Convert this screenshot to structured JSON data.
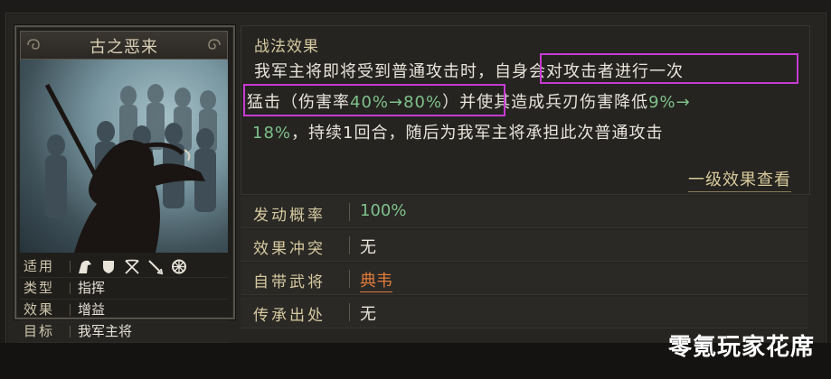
{
  "card": {
    "title": "古之恶来",
    "properties": [
      {
        "key": "适用",
        "type": "icons",
        "icons": [
          "cavalry-icon",
          "shield-icon",
          "crossed-bows-icon",
          "spear-icon",
          "wheel-icon"
        ]
      },
      {
        "key": "类型",
        "value": "指挥"
      },
      {
        "key": "效果",
        "value": "增益"
      },
      {
        "key": "目标",
        "value": "我军主将"
      }
    ]
  },
  "effect": {
    "heading": "战法效果",
    "line1_a": "我军主将即将受到普通攻击时，",
    "line1_b": "自身会对攻击者进行一次",
    "line2_a": "猛击（伤害率",
    "line2_green": "40%→80%",
    "line2_b": "）",
    "line2_c": "并使其造成兵刃伤害降低",
    "line2_green2": "9%→",
    "line3_green": "18%",
    "line3_b": "，持续1回合，随后为我军主将承担此次普通攻击",
    "level_link": "一级效果查看"
  },
  "info": [
    {
      "key": "发动概率",
      "value": "100%",
      "style": "green"
    },
    {
      "key": "效果冲突",
      "value": "无",
      "style": "plain"
    },
    {
      "key": "自带武将",
      "value": "典韦",
      "style": "orange"
    },
    {
      "key": "传承出处",
      "value": "无",
      "style": "plain"
    }
  ],
  "watermark": "零氪玩家花席",
  "colors": {
    "highlight_border": "#c63bd1",
    "value_green": "#7fc18a",
    "general_orange": "#e07a3a",
    "label_gold": "#d6c99f"
  }
}
